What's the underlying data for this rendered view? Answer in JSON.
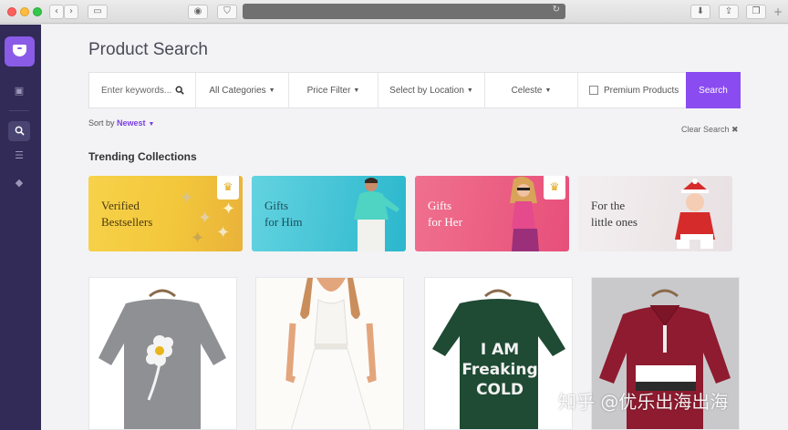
{
  "browser": {
    "nav_back": "‹",
    "nav_forward": "›",
    "reload": "↻",
    "new_tab": "+"
  },
  "page": {
    "title": "Product Search"
  },
  "search": {
    "placeholder": "Enter keywords...",
    "categories": "All Categories",
    "price_filter": "Price Filter",
    "location": "Select by Location",
    "brand": "Celeste",
    "premium": "Premium Products",
    "button": "Search"
  },
  "sort": {
    "label": "Sort by",
    "value": "Newest"
  },
  "clear_search": "Clear Search ✖",
  "trending": {
    "title": "Trending Collections",
    "items": [
      {
        "label": "Verified\nBestsellers",
        "premium": true
      },
      {
        "label": "Gifts\nfor Him",
        "premium": false
      },
      {
        "label": "Gifts\nfor Her",
        "premium": true
      },
      {
        "label": "For the\nlittle ones",
        "premium": false
      }
    ]
  },
  "products": [
    {
      "text": ""
    },
    {
      "text": ""
    },
    {
      "text": "I AM\nFreaking\nCOLD"
    },
    {
      "text": ""
    }
  ],
  "watermark": "知乎 @优乐出海出海",
  "colors": {
    "accent": "#8a4cf0",
    "sidebar": "#322a57",
    "logo": "#8a5be6"
  }
}
